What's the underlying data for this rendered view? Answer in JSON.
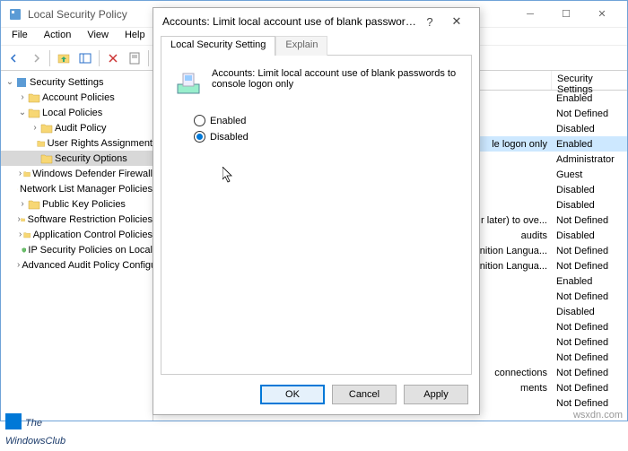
{
  "window": {
    "title": "Local Security Policy",
    "menus": [
      "File",
      "Action",
      "View",
      "Help"
    ]
  },
  "tree": {
    "root": "Security Settings",
    "items": [
      {
        "label": "Account Policies",
        "indent": 1,
        "exp": "›"
      },
      {
        "label": "Local Policies",
        "indent": 1,
        "exp": "⌄"
      },
      {
        "label": "Audit Policy",
        "indent": 2,
        "exp": "›"
      },
      {
        "label": "User Rights Assignment",
        "indent": 2,
        "exp": ""
      },
      {
        "label": "Security Options",
        "indent": 2,
        "exp": "",
        "selected": true
      },
      {
        "label": "Windows Defender Firewall",
        "indent": 1,
        "exp": "›"
      },
      {
        "label": "Network List Manager Policies",
        "indent": 1,
        "exp": ""
      },
      {
        "label": "Public Key Policies",
        "indent": 1,
        "exp": "›"
      },
      {
        "label": "Software Restriction Policies",
        "indent": 1,
        "exp": "›"
      },
      {
        "label": "Application Control Policies",
        "indent": 1,
        "exp": "›"
      },
      {
        "label": "IP Security Policies on Local",
        "indent": 1,
        "exp": "",
        "special": true
      },
      {
        "label": "Advanced Audit Policy Configuration",
        "indent": 1,
        "exp": "›"
      }
    ]
  },
  "list": {
    "header": "Security Settings",
    "rows": [
      {
        "partial": "",
        "value": "Enabled"
      },
      {
        "partial": "",
        "value": "Not Defined"
      },
      {
        "partial": "",
        "value": "Disabled"
      },
      {
        "partial": "le logon only",
        "value": "Enabled",
        "hl": true
      },
      {
        "partial": "",
        "value": "Administrator"
      },
      {
        "partial": "",
        "value": "Guest"
      },
      {
        "partial": "",
        "value": "Disabled"
      },
      {
        "partial": "",
        "value": "Disabled"
      },
      {
        "partial": "r later) to ove...",
        "value": "Not Defined"
      },
      {
        "partial": "audits",
        "value": "Disabled"
      },
      {
        "partial": "inition Langua...",
        "value": "Not Defined"
      },
      {
        "partial": "inition Langua...",
        "value": "Not Defined"
      },
      {
        "partial": "",
        "value": "Enabled"
      },
      {
        "partial": "",
        "value": "Not Defined"
      },
      {
        "partial": "",
        "value": "Disabled"
      },
      {
        "partial": "",
        "value": "Not Defined"
      },
      {
        "partial": "",
        "value": "Not Defined"
      },
      {
        "partial": "",
        "value": "Not Defined"
      },
      {
        "partial": "connections",
        "value": "Not Defined"
      },
      {
        "partial": "ments",
        "value": "Not Defined"
      },
      {
        "partial": "",
        "value": "Not Defined"
      }
    ]
  },
  "dialog": {
    "title": "Accounts: Limit local account use of blank passwords to c...",
    "tabs": {
      "active": "Local Security Setting",
      "inactive": "Explain"
    },
    "description": "Accounts: Limit local account use of blank passwords to console logon only",
    "options": {
      "enabled": "Enabled",
      "disabled": "Disabled",
      "selected": "disabled"
    },
    "buttons": {
      "ok": "OK",
      "cancel": "Cancel",
      "apply": "Apply"
    }
  },
  "watermark": {
    "line1": "The",
    "line2": "WindowsClub"
  },
  "wsx": "wsxdn.com"
}
